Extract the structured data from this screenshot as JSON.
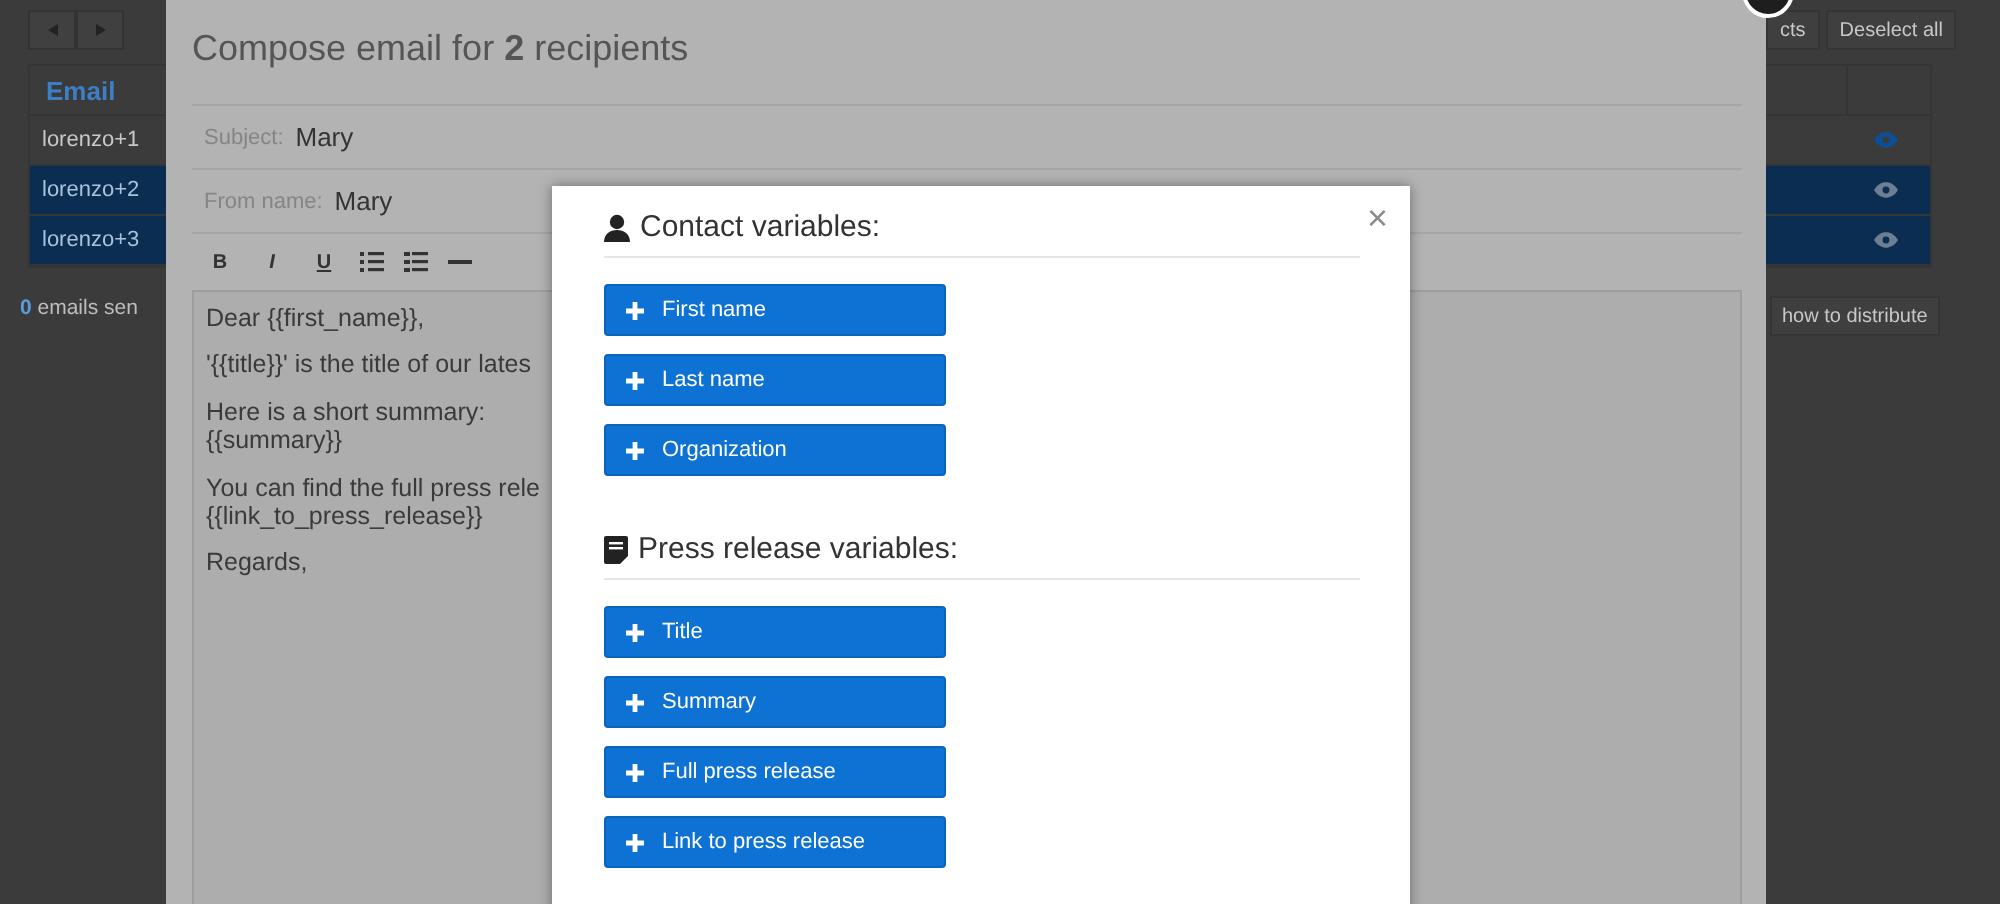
{
  "page": {
    "table": {
      "column_1": "Email",
      "rows": [
        {
          "email": "lorenzo+1",
          "selected": false
        },
        {
          "email": "lorenzo+2",
          "selected": true
        },
        {
          "email": "lorenzo+3",
          "selected": true
        }
      ]
    },
    "sent_count": "**0** emails sen",
    "top_buttons": [
      "cts",
      "Deselect all"
    ],
    "distribute_button": "how to distribute"
  },
  "compose": {
    "title": "Compose email for **2** recipients",
    "fields": [
      {
        "label": "Subject:",
        "value": "Mary"
      },
      {
        "label": "From name:",
        "value": "Mary"
      }
    ],
    "format_buttons": [
      "B",
      "I",
      "U"
    ],
    "body": [
      "Dear {{first_name}},",
      "'{{title}}' is the title of our lates",
      "Here is a short summary:\n{{summary}}",
      "You can find the full press rele\n{{link_to_press_release}}",
      "Regards,"
    ]
  },
  "variables_dialog": {
    "close": "×",
    "sections": [
      {
        "kind": "contact",
        "heading": "Contact variables:",
        "buttons": [
          "First name",
          "Last name",
          "Organization"
        ]
      },
      {
        "kind": "press_release",
        "heading": "Press release variables:",
        "buttons": [
          "Title",
          "Summary",
          "Full press release",
          "Link to press release"
        ]
      }
    ]
  }
}
